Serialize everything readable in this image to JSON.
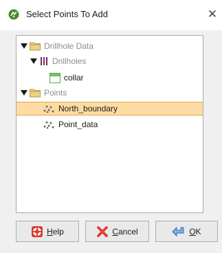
{
  "dialog": {
    "title": "Select Points To Add",
    "close_glyph": "✕"
  },
  "tree": {
    "nodes": [
      {
        "label": "Drillhole Data",
        "icon": "folder-icon",
        "expanded": true
      },
      {
        "label": "Drillholes",
        "icon": "drillholes-icon",
        "expanded": true
      },
      {
        "label": "collar",
        "icon": "table-icon"
      },
      {
        "label": "Points",
        "icon": "folder-icon",
        "expanded": true
      },
      {
        "label": "North_boundary",
        "icon": "points-icon",
        "selected": true
      },
      {
        "label": "Point_data",
        "icon": "points-icon"
      }
    ]
  },
  "buttons": {
    "help": {
      "label_mnemonic": "H",
      "label_rest": "elp",
      "icon": "lifebuoy-icon"
    },
    "cancel": {
      "label_mnemonic": "C",
      "label_rest": "ancel",
      "icon": "cancel-x-icon"
    },
    "ok": {
      "label_mnemonic": "O",
      "label_rest": "K",
      "icon": "ok-arrow-icon"
    }
  },
  "colors": {
    "selection_fill": "#fcdca4",
    "selection_border": "#e8a441",
    "folder": "#e3c777",
    "drillhole_blue": "#2b3ea8",
    "drillhole_red": "#c0202a",
    "table_green": "#5aa84a"
  }
}
